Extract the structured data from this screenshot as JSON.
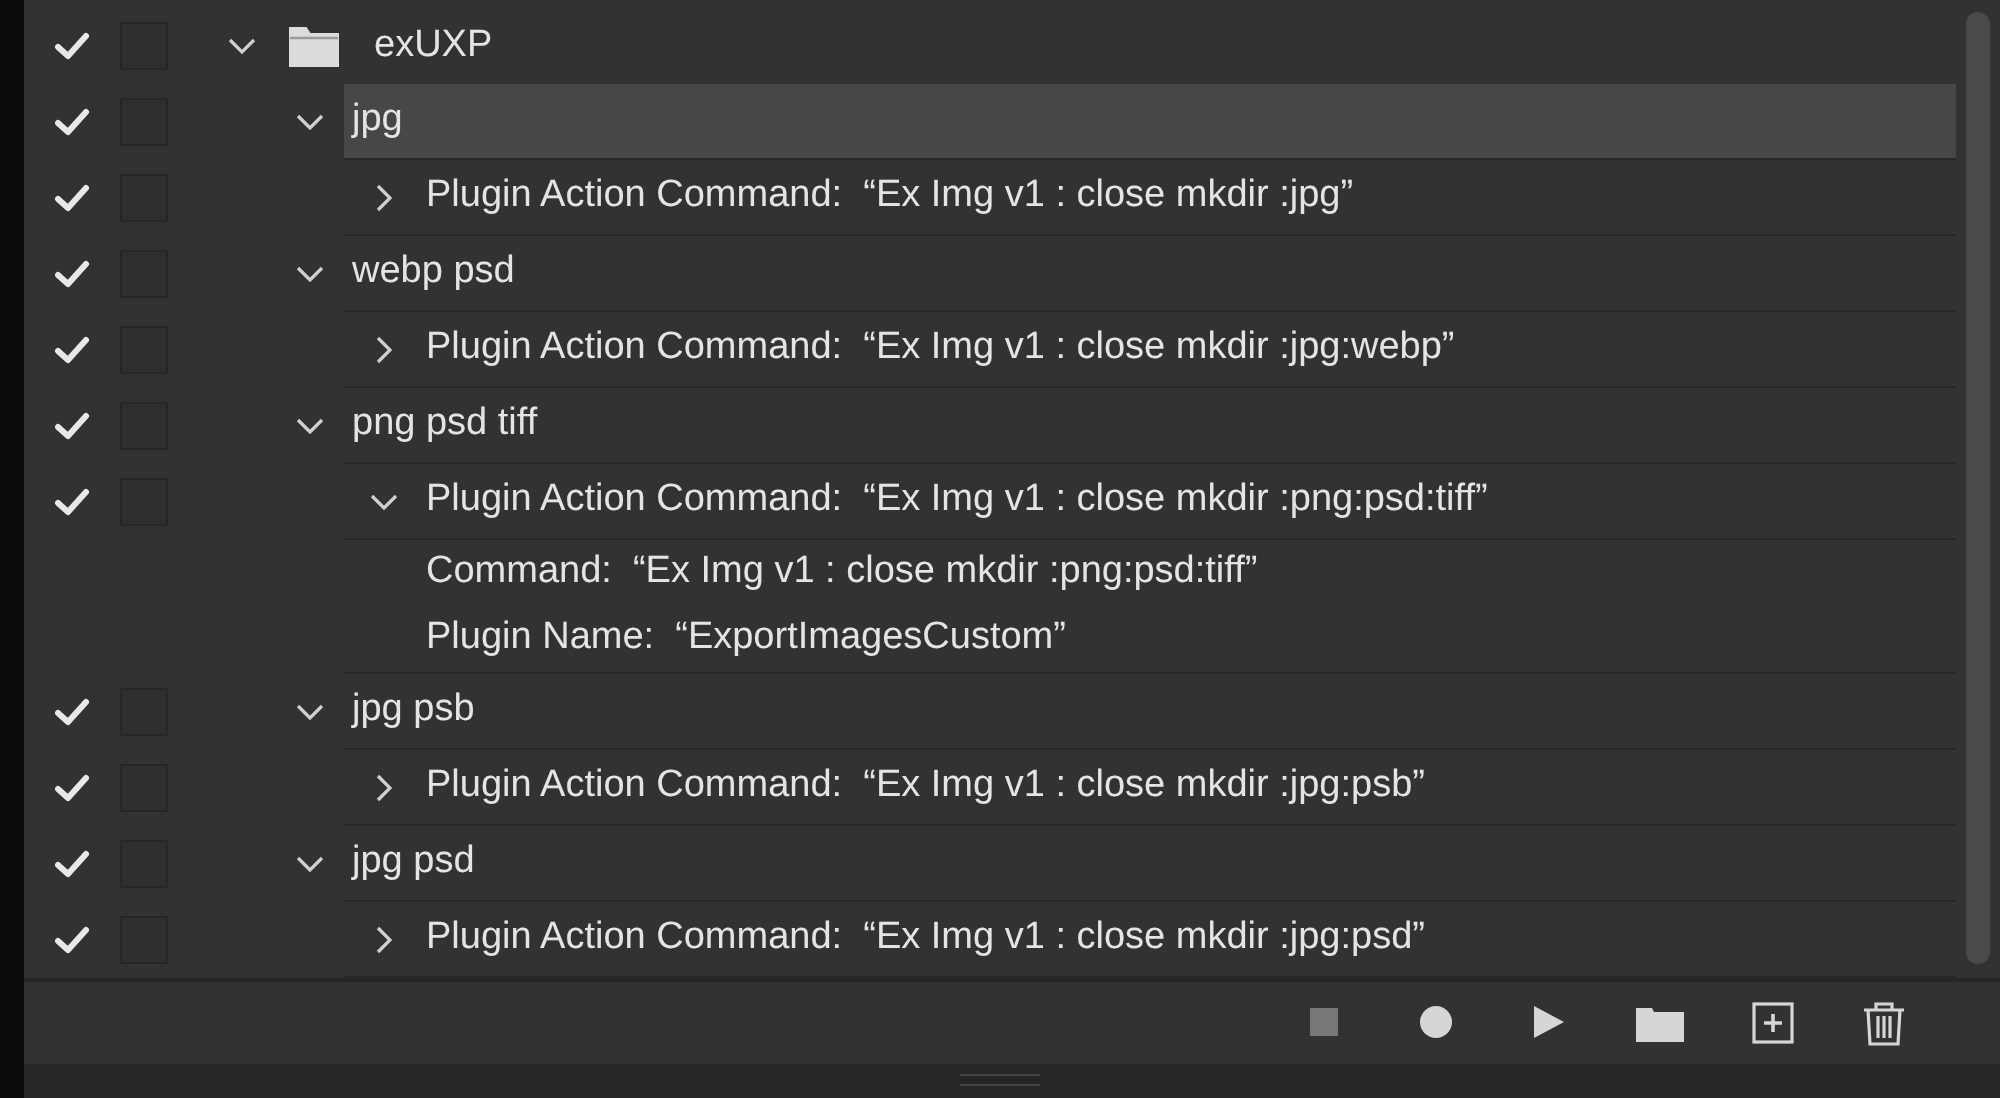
{
  "action_set": {
    "name": "exUXP",
    "included": true,
    "dialog": false,
    "expanded": true,
    "actions": [
      {
        "name": "jpg",
        "included": true,
        "dialog": false,
        "expanded": true,
        "selected": true,
        "steps": [
          {
            "text": "Plugin Action Command:  “Ex Img v1 : close mkdir :jpg”",
            "included": true,
            "dialog": false,
            "expanded": false
          }
        ]
      },
      {
        "name": "webp psd",
        "included": true,
        "dialog": false,
        "expanded": true,
        "selected": false,
        "steps": [
          {
            "text": "Plugin Action Command:  “Ex Img v1 : close mkdir :jpg:webp”",
            "included": true,
            "dialog": false,
            "expanded": false
          }
        ]
      },
      {
        "name": "png psd tiff",
        "included": true,
        "dialog": false,
        "expanded": true,
        "selected": false,
        "steps": [
          {
            "text": "Plugin Action Command:  “Ex Img v1 : close mkdir :png:psd:tiff”",
            "included": true,
            "dialog": false,
            "expanded": true,
            "details": [
              "Command:  “Ex Img v1 : close mkdir :png:psd:tiff”",
              "Plugin Name:  “ExportImagesCustom”"
            ]
          }
        ]
      },
      {
        "name": "jpg psb",
        "included": true,
        "dialog": false,
        "expanded": true,
        "selected": false,
        "steps": [
          {
            "text": "Plugin Action Command:  “Ex Img v1 : close mkdir :jpg:psb”",
            "included": true,
            "dialog": false,
            "expanded": false
          }
        ]
      },
      {
        "name": "jpg psd",
        "included": true,
        "dialog": false,
        "expanded": true,
        "selected": false,
        "steps": [
          {
            "text": "Plugin Action Command:  “Ex Img v1 : close mkdir :jpg:psd”",
            "included": true,
            "dialog": false,
            "expanded": false
          }
        ]
      }
    ]
  },
  "toolbar": [
    {
      "kind": "stop",
      "disabled": true
    },
    {
      "kind": "record",
      "disabled": false
    },
    {
      "kind": "play",
      "disabled": false
    },
    {
      "kind": "folder",
      "disabled": false
    },
    {
      "kind": "new",
      "disabled": false
    },
    {
      "kind": "delete",
      "disabled": false
    }
  ]
}
